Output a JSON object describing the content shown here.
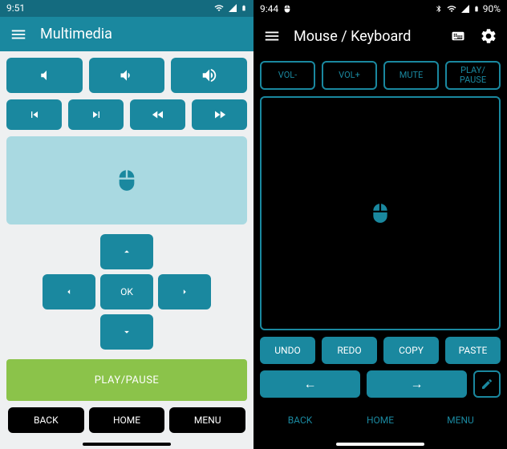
{
  "left": {
    "status_time": "9:51",
    "title": "Multimedia",
    "dpad_ok": "OK",
    "play_label": "PLAY/PAUSE",
    "nav": {
      "back": "BACK",
      "home": "HOME",
      "menu": "MENU"
    }
  },
  "right": {
    "status_time": "9:44",
    "battery": "90%",
    "title": "Mouse / Keyboard",
    "top": {
      "vol_down": "VOL-",
      "vol_up": "VOL+",
      "mute": "MUTE",
      "play": "PLAY/\nPAUSE"
    },
    "actions": {
      "undo": "UNDO",
      "redo": "REDO",
      "copy": "COPY",
      "paste": "PASTE"
    },
    "arrows": {
      "left": "←",
      "right": "→"
    },
    "nav": {
      "back": "BACK",
      "home": "HOME",
      "menu": "MENU"
    }
  }
}
